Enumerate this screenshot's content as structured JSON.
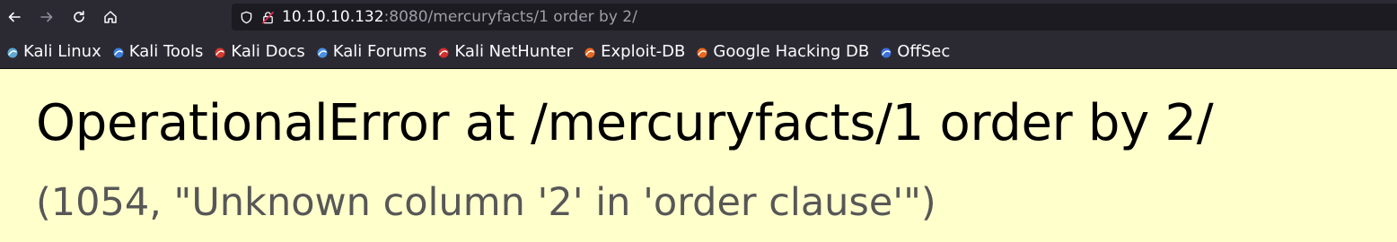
{
  "browser": {
    "url_host": "10.10.10.132",
    "url_rest": ":8080/mercuryfacts/1 order by 2/"
  },
  "bookmarks": [
    {
      "label": "Kali Linux",
      "icon": "kali-dragon-icon",
      "color": "#5fa8d3"
    },
    {
      "label": "Kali Tools",
      "icon": "kali-tools-icon",
      "color": "#3b7fd9"
    },
    {
      "label": "Kali Docs",
      "icon": "kali-docs-icon",
      "color": "#d33a2c"
    },
    {
      "label": "Kali Forums",
      "icon": "kali-forums-icon",
      "color": "#4a90e2"
    },
    {
      "label": "Kali NetHunter",
      "icon": "nethunter-icon",
      "color": "#d32f2f"
    },
    {
      "label": "Exploit-DB",
      "icon": "exploit-db-icon",
      "color": "#e8681f"
    },
    {
      "label": "Google Hacking DB",
      "icon": "ghdb-icon",
      "color": "#e8681f"
    },
    {
      "label": "OffSec",
      "icon": "offsec-icon",
      "color": "#3b6fd9"
    }
  ],
  "error": {
    "title": "OperationalError at /mercuryfacts/1 order by 2/",
    "detail": "(1054, \"Unknown column '2' in 'order clause'\")"
  },
  "colors": {
    "page_background": "#ffffcc",
    "toolbar": "#2b2a33",
    "urlbar": "#1c1b22"
  }
}
